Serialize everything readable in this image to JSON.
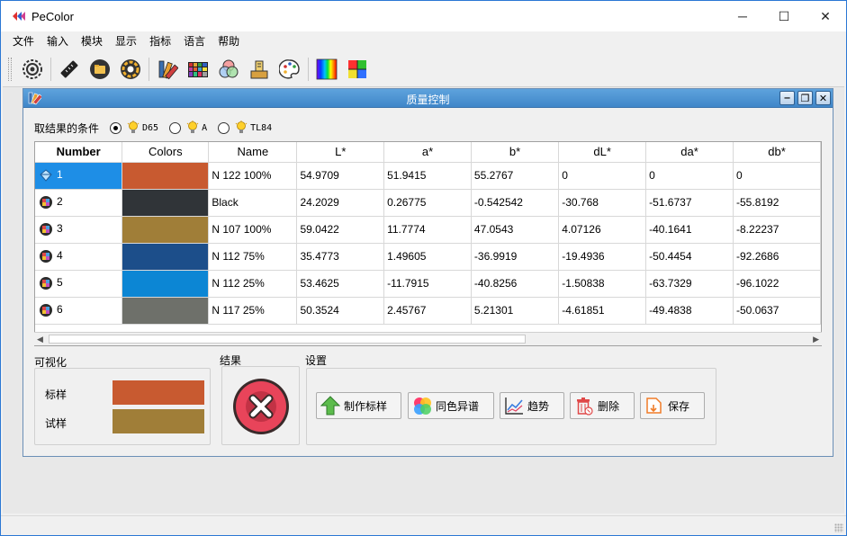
{
  "app": {
    "title": "PeColor"
  },
  "window_controls": {
    "minimize": "─",
    "maximize": "☐",
    "close": "✕"
  },
  "menu": [
    "文件",
    "输入",
    "模块",
    "显示",
    "指标",
    "语言",
    "帮助"
  ],
  "toolbar_icons": [
    "settings-gear-icon",
    "ruler-icon",
    "open-folder-icon",
    "color-wheel-icon",
    "color-fan-icon",
    "color-grid-icon",
    "rgb-circles-icon",
    "spectrometer-icon",
    "palette-icon",
    "spectrum-icon",
    "color-square-icon"
  ],
  "subwindow": {
    "title": "质量控制",
    "controls": {
      "minimize": "‒",
      "restore": "❐",
      "close": "✕"
    }
  },
  "condition": {
    "label": "取结果的条件",
    "options": [
      {
        "label": "D65",
        "selected": true
      },
      {
        "label": "A",
        "selected": false
      },
      {
        "label": "TL84",
        "selected": false
      }
    ]
  },
  "table": {
    "columns": [
      "Number",
      "Colors",
      "Name",
      "L*",
      "a*",
      "b*",
      "dL*",
      "da*",
      "db*"
    ],
    "rows": [
      {
        "number": "1",
        "color": "#c85a30",
        "name": "N 122 100%",
        "L": "54.9709",
        "a": "51.9415",
        "b": "55.2767",
        "dL": "0",
        "da": "0",
        "db": "0",
        "selected": true
      },
      {
        "number": "2",
        "color": "#303438",
        "name": "Black",
        "L": "24.2029",
        "a": "0.26775",
        "b": "-0.542542",
        "dL": "-30.768",
        "da": "-51.6737",
        "db": "-55.8192",
        "selected": false
      },
      {
        "number": "3",
        "color": "#a07e38",
        "name": "N 107 100%",
        "L": "59.0422",
        "a": "11.7774",
        "b": "47.0543",
        "dL": "4.07126",
        "da": "-40.1641",
        "db": "-8.22237",
        "selected": false
      },
      {
        "number": "4",
        "color": "#1c4e8a",
        "name": "N 112 75%",
        "L": "35.4773",
        "a": "1.49605",
        "b": "-36.9919",
        "dL": "-19.4936",
        "da": "-50.4454",
        "db": "-92.2686",
        "selected": false
      },
      {
        "number": "5",
        "color": "#0c86d4",
        "name": "N 112 25%",
        "L": "53.4625",
        "a": "-11.7915",
        "b": "-40.8256",
        "dL": "-1.50838",
        "da": "-63.7329",
        "db": "-96.1022",
        "selected": false
      },
      {
        "number": "6",
        "color": "#6e706a",
        "name": "N 117 25%",
        "L": "50.3524",
        "a": "2.45767",
        "b": "5.21301",
        "dL": "-4.61851",
        "da": "-49.4838",
        "db": "-50.0637",
        "selected": false
      }
    ]
  },
  "visualize": {
    "title": "可视化",
    "standard_label": "标样",
    "standard_color": "#c85a30",
    "sample_label": "试样",
    "sample_color": "#a07e38"
  },
  "result": {
    "title": "结果",
    "status": "fail",
    "color": "#e8445a"
  },
  "settings": {
    "title": "设置",
    "buttons": [
      {
        "label": "制作标样",
        "icon": "green-up-arrow-icon"
      },
      {
        "label": "同色异谱",
        "icon": "color-balls-icon"
      },
      {
        "label": "趋势",
        "icon": "trend-chart-icon"
      },
      {
        "label": "删除",
        "icon": "trash-icon"
      },
      {
        "label": "保存",
        "icon": "save-icon"
      }
    ]
  }
}
